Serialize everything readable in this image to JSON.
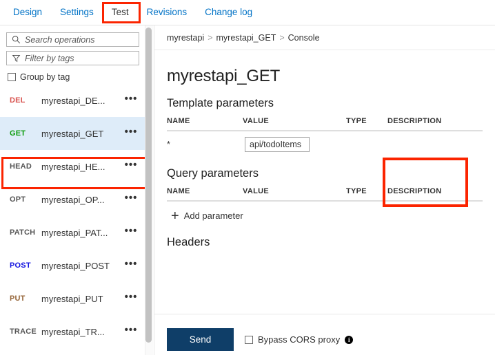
{
  "tabs": {
    "items": [
      {
        "label": "Design",
        "active": false
      },
      {
        "label": "Settings",
        "active": false
      },
      {
        "label": "Test",
        "active": true
      },
      {
        "label": "Revisions",
        "active": false
      },
      {
        "label": "Change log",
        "active": false
      }
    ]
  },
  "sidebar": {
    "search": {
      "placeholder": "Search operations",
      "value": "",
      "icon": "search-icon"
    },
    "filter": {
      "placeholder": "Filter by tags",
      "value": "",
      "icon": "filter-icon"
    },
    "group_by_tag": {
      "label": "Group by tag",
      "checked": false
    },
    "operations": [
      {
        "verb": "DEL",
        "name": "myrestapi_DE...",
        "color": "#d9534f",
        "selected": false
      },
      {
        "verb": "GET",
        "name": "myrestapi_GET",
        "color": "#0f9d0f",
        "selected": true
      },
      {
        "verb": "HEAD",
        "name": "myrestapi_HE...",
        "color": "#555555",
        "selected": false
      },
      {
        "verb": "OPT",
        "name": "myrestapi_OP...",
        "color": "#555555",
        "selected": false
      },
      {
        "verb": "PATCH",
        "name": "myrestapi_PAT...",
        "color": "#555555",
        "selected": false
      },
      {
        "verb": "POST",
        "name": "myrestapi_POST",
        "color": "#1414e0",
        "selected": false
      },
      {
        "verb": "PUT",
        "name": "myrestapi_PUT",
        "color": "#96663a",
        "selected": false
      },
      {
        "verb": "TRACE",
        "name": "myrestapi_TR...",
        "color": "#555555",
        "selected": false
      }
    ],
    "row_menu_glyph": "•••"
  },
  "breadcrumb": {
    "items": [
      "myrestapi",
      "myrestapi_GET",
      "Console"
    ],
    "separator": ">"
  },
  "main": {
    "title": "myrestapi_GET",
    "template_parameters": {
      "heading": "Template parameters",
      "columns": [
        "NAME",
        "VALUE",
        "TYPE",
        "DESCRIPTION"
      ],
      "rows": [
        {
          "name": "*",
          "value": "api/todoItems",
          "type": "",
          "description": ""
        }
      ]
    },
    "query_parameters": {
      "heading": "Query parameters",
      "columns": [
        "NAME",
        "VALUE",
        "TYPE",
        "DESCRIPTION"
      ],
      "rows": [],
      "add_label": "Add parameter",
      "add_icon": "plus-icon"
    },
    "headers": {
      "heading": "Headers"
    }
  },
  "footer": {
    "send_label": "Send",
    "bypass_cors": {
      "label": "Bypass CORS proxy",
      "checked": false,
      "info_icon": "info-icon"
    }
  },
  "highlights": {
    "color": "#fb2400",
    "targets": [
      "test-tab",
      "get-operation-row",
      "template-value-column"
    ]
  }
}
